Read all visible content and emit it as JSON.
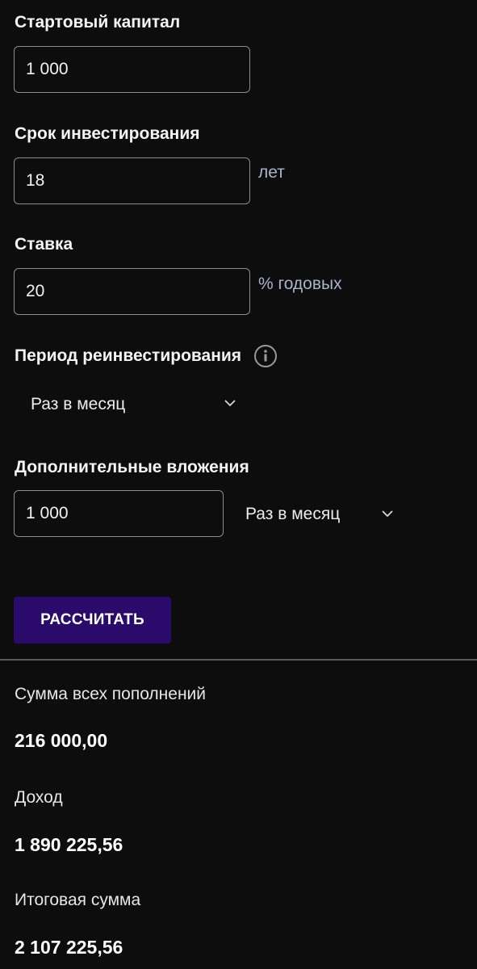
{
  "form": {
    "start_capital": {
      "label": "Стартовый капитал",
      "value": "1 000"
    },
    "term": {
      "label": "Срок инвестирования",
      "value": "18",
      "unit": "лет"
    },
    "rate": {
      "label": "Ставка",
      "value": "20",
      "unit": "% годовых"
    },
    "reinvest_period": {
      "label": "Период реинвестирования",
      "selected": "Раз в месяц",
      "icon": "info-icon"
    },
    "additional": {
      "label": "Дополнительные вложения",
      "value": "1 000",
      "frequency_selected": "Раз в месяц"
    },
    "calculate_label": "РАССЧИТАТЬ"
  },
  "results": {
    "total_contributions": {
      "label": "Сумма всех пополнений",
      "value": "216 000,00"
    },
    "income": {
      "label": "Доход",
      "value": "1 890 225,56"
    },
    "final_sum": {
      "label": "Итоговая сумма",
      "value": "2 107 225,56"
    }
  },
  "colors": {
    "background": "#0d0d0e",
    "button": "#2a0b6b",
    "unit_text": "#a9b3c9",
    "input_border": "#8c8c8c"
  }
}
